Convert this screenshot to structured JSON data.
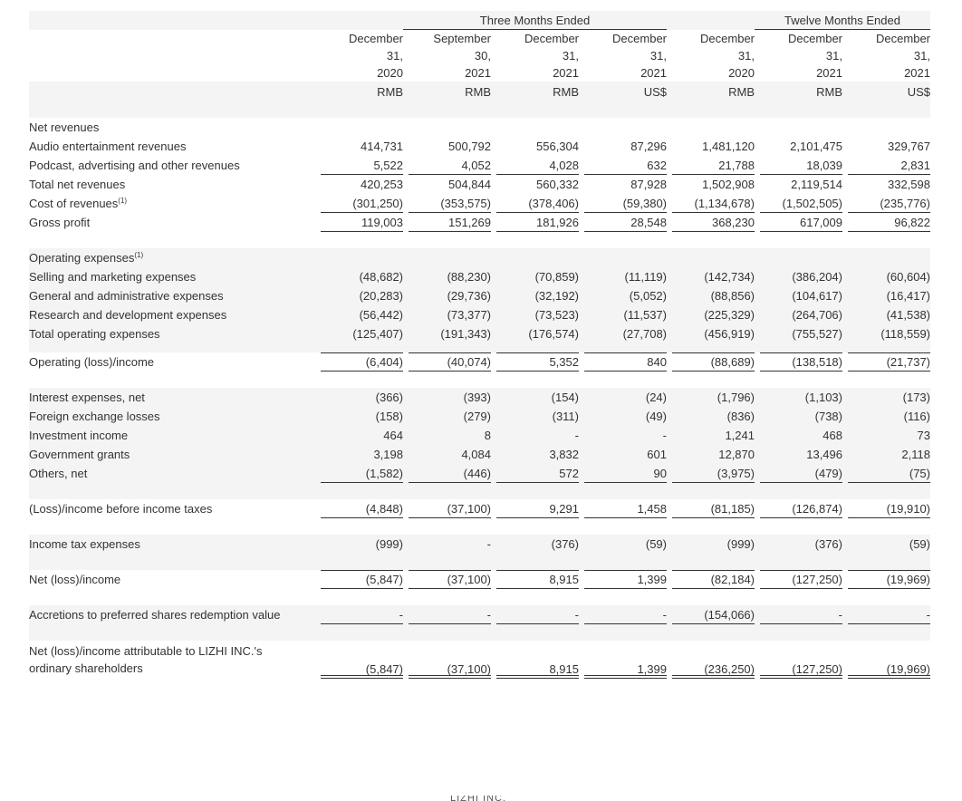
{
  "header": {
    "group_three_months": "Three Months Ended",
    "group_twelve_months": "Twelve Months Ended",
    "columns": [
      {
        "l1": "December",
        "l2": "31,",
        "l3": "2020",
        "cur": "RMB"
      },
      {
        "l1": "September",
        "l2": "30,",
        "l3": "2021",
        "cur": "RMB"
      },
      {
        "l1": "December",
        "l2": "31,",
        "l3": "2021",
        "cur": "RMB"
      },
      {
        "l1": "December",
        "l2": "31,",
        "l3": "2021",
        "cur": "US$"
      },
      {
        "l1": "December",
        "l2": "31,",
        "l3": "2020",
        "cur": "RMB"
      },
      {
        "l1": "December",
        "l2": "31,",
        "l3": "2021",
        "cur": "RMB"
      },
      {
        "l1": "December",
        "l2": "31,",
        "l3": "2021",
        "cur": "US$"
      }
    ]
  },
  "rows": [
    {
      "kind": "spacer"
    },
    {
      "kind": "data",
      "label": "Net revenues",
      "values": [
        "",
        "",
        "",
        "",
        "",
        "",
        ""
      ]
    },
    {
      "kind": "data",
      "label": "Audio entertainment revenues",
      "values": [
        "414,731",
        "500,792",
        "556,304",
        "87,296",
        "1,481,120",
        "2,101,475",
        "329,767"
      ]
    },
    {
      "kind": "data",
      "label": "Podcast, advertising and other revenues",
      "values": [
        "5,522",
        "4,052",
        "4,028",
        "632",
        "21,788",
        "18,039",
        "2,831"
      ],
      "line": "b"
    },
    {
      "kind": "data",
      "label": "Total net revenues",
      "values": [
        "420,253",
        "504,844",
        "560,332",
        "87,928",
        "1,502,908",
        "2,119,514",
        "332,598"
      ]
    },
    {
      "kind": "data",
      "label": "Cost of revenues",
      "sup": "(1)",
      "values": [
        "(301,250)",
        "(353,575)",
        "(378,406)",
        "(59,380)",
        "(1,134,678)",
        "(1,502,505)",
        "(235,776)"
      ],
      "line": "b"
    },
    {
      "kind": "data",
      "label": "Gross profit",
      "values": [
        "119,003",
        "151,269",
        "181,926",
        "28,548",
        "368,230",
        "617,009",
        "96,822"
      ],
      "line": "b"
    },
    {
      "kind": "spacer"
    },
    {
      "kind": "data",
      "label": "Operating expenses",
      "sup": "(1)",
      "values": [
        "",
        "",
        "",
        "",
        "",
        "",
        ""
      ]
    },
    {
      "kind": "data",
      "label": "Selling and marketing expenses",
      "values": [
        "(48,682)",
        "(88,230)",
        "(70,859)",
        "(11,119)",
        "(142,734)",
        "(386,204)",
        "(60,604)"
      ]
    },
    {
      "kind": "data",
      "label": "General and administrative expenses",
      "values": [
        "(20,283)",
        "(29,736)",
        "(32,192)",
        "(5,052)",
        "(88,856)",
        "(104,617)",
        "(16,417)"
      ]
    },
    {
      "kind": "data",
      "label": "Research and development expenses",
      "values": [
        "(56,442)",
        "(73,377)",
        "(73,523)",
        "(11,537)",
        "(225,329)",
        "(264,706)",
        "(41,538)"
      ]
    },
    {
      "kind": "data",
      "label": "Total operating expenses",
      "values": [
        "(125,407)",
        "(191,343)",
        "(176,574)",
        "(27,708)",
        "(456,919)",
        "(755,527)",
        "(118,559)"
      ]
    },
    {
      "kind": "spacer-s"
    },
    {
      "kind": "data",
      "label": "Operating (loss)/income",
      "values": [
        "(6,404)",
        "(40,074)",
        "5,352",
        "840",
        "(88,689)",
        "(138,518)",
        "(21,737)"
      ],
      "line": "tb"
    },
    {
      "kind": "spacer"
    },
    {
      "kind": "data",
      "label": "Interest expenses, net",
      "values": [
        "(366)",
        "(393)",
        "(154)",
        "(24)",
        "(1,796)",
        "(1,103)",
        "(173)"
      ]
    },
    {
      "kind": "data",
      "label": "Foreign exchange losses",
      "values": [
        "(158)",
        "(279)",
        "(311)",
        "(49)",
        "(836)",
        "(738)",
        "(116)"
      ]
    },
    {
      "kind": "data",
      "label": "Investment income",
      "values": [
        "464",
        "8",
        "-",
        "-",
        "1,241",
        "468",
        "73"
      ]
    },
    {
      "kind": "data",
      "label": "Government grants",
      "values": [
        "3,198",
        "4,084",
        "3,832",
        "601",
        "12,870",
        "13,496",
        "2,118"
      ]
    },
    {
      "kind": "data",
      "label": "Others, net",
      "values": [
        "(1,582)",
        "(446)",
        "572",
        "90",
        "(3,975)",
        "(479)",
        "(75)"
      ],
      "line": "b"
    },
    {
      "kind": "spacer"
    },
    {
      "kind": "data",
      "label": "(Loss)/income before income taxes",
      "values": [
        "(4,848)",
        "(37,100)",
        "9,291",
        "1,458",
        "(81,185)",
        "(126,874)",
        "(19,910)"
      ],
      "line": "b"
    },
    {
      "kind": "spacer"
    },
    {
      "kind": "data",
      "label": "Income tax expenses",
      "values": [
        "(999)",
        "-",
        "(376)",
        "(59)",
        "(999)",
        "(376)",
        "(59)"
      ]
    },
    {
      "kind": "spacer"
    },
    {
      "kind": "data",
      "label": "Net (loss)/income",
      "values": [
        "(5,847)",
        "(37,100)",
        "8,915",
        "1,399",
        "(82,184)",
        "(127,250)",
        "(19,969)"
      ],
      "line": "tb"
    },
    {
      "kind": "spacer"
    },
    {
      "kind": "data",
      "label": "Accretions to preferred shares redemption value",
      "values": [
        "-",
        "-",
        "-",
        "-",
        "(154,066)",
        "-",
        "-"
      ],
      "line": "b"
    },
    {
      "kind": "spacer"
    },
    {
      "kind": "data2",
      "label": "Net (loss)/income attributable to LIZHI INC.'s",
      "label2": "ordinary shareholders",
      "values": [
        "(5,847)",
        "(37,100)",
        "8,915",
        "1,399",
        "(236,250)",
        "(127,250)",
        "(19,969)"
      ],
      "line": "bb"
    },
    {
      "kind": "spacer"
    }
  ],
  "footer_fragment": "LIZHI INC."
}
